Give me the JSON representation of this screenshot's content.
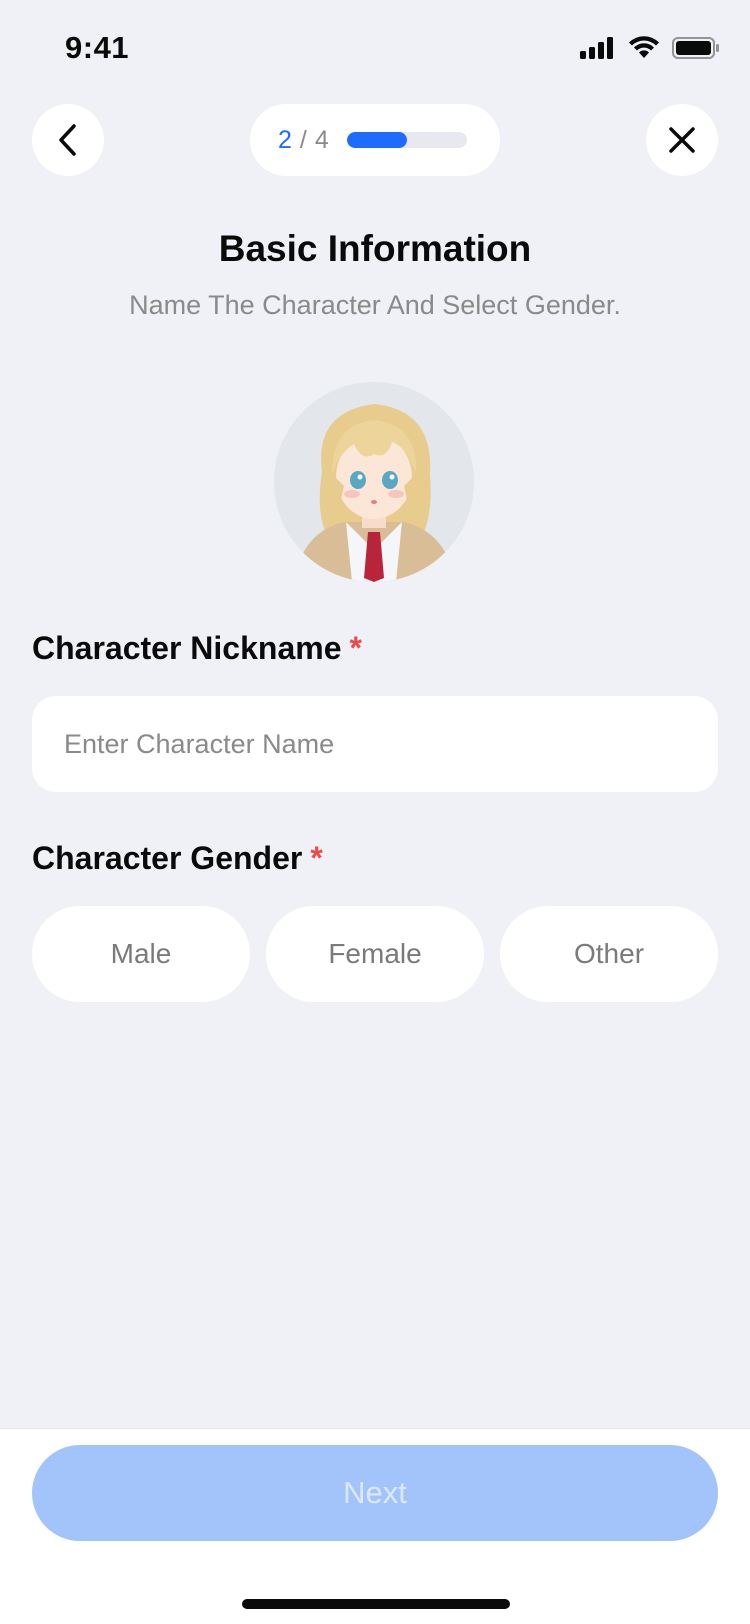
{
  "status_bar": {
    "time": "9:41"
  },
  "header": {
    "step_current": "2",
    "step_separator": "/",
    "step_total": "4",
    "progress_fraction": 0.5
  },
  "title": "Basic Information",
  "subtitle": "Name The Character And Select Gender.",
  "avatar": {
    "icon": "anime-girl-avatar"
  },
  "nickname": {
    "label": "Character Nickname",
    "required_mark": "*",
    "placeholder": "Enter Character Name",
    "value": ""
  },
  "gender": {
    "label": "Character Gender",
    "required_mark": "*",
    "options": [
      "Male",
      "Female",
      "Other"
    ]
  },
  "footer": {
    "next_label": "Next"
  },
  "colors": {
    "accent": "#1E6BFF",
    "required": "#F04848",
    "background": "#F0F1F7",
    "next_disabled": "#A3C4FB"
  }
}
